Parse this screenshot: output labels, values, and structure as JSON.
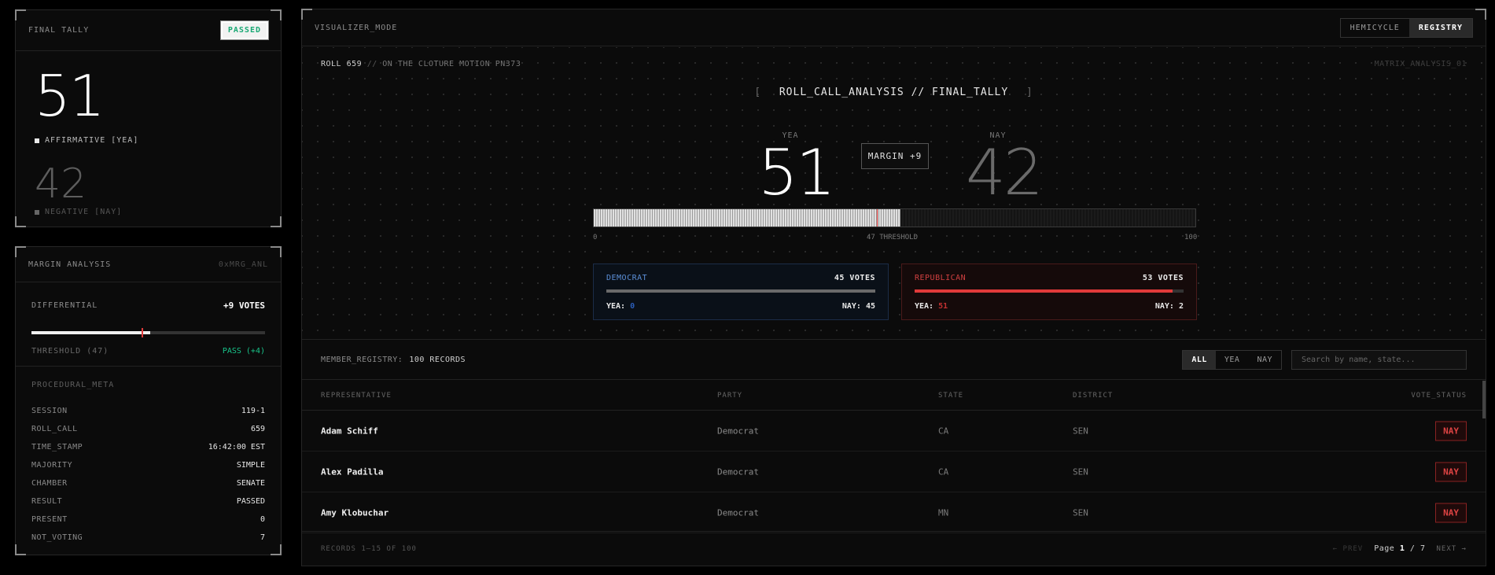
{
  "tally": {
    "title": "FINAL TALLY",
    "status": "PASSED",
    "yea": "51",
    "yea_label": "AFFIRMATIVE [YEA]",
    "nay": "42",
    "nay_label": "NEGATIVE [NAY]"
  },
  "margin": {
    "title": "MARGIN ANALYSIS",
    "code": "0xMRG_ANL",
    "differential_label": "DIFFERENTIAL",
    "differential_value": "+9 VOTES",
    "bar_fill_fraction": 0.51,
    "threshold_fraction": 0.47,
    "threshold_label": "THRESHOLD (47)",
    "threshold_result": "PASS (+4)",
    "procedural_title": "PROCEDURAL_META",
    "meta": [
      {
        "k": "SESSION",
        "v": "119-1"
      },
      {
        "k": "ROLL_CALL",
        "v": "659"
      },
      {
        "k": "TIME_STAMP",
        "v": "16:42:00 EST"
      },
      {
        "k": "MAJORITY",
        "v": "SIMPLE"
      },
      {
        "k": "CHAMBER",
        "v": "SENATE"
      },
      {
        "k": "RESULT",
        "v": "PASSED"
      },
      {
        "k": "PRESENT",
        "v": "0"
      },
      {
        "k": "NOT_VOTING",
        "v": "7"
      }
    ]
  },
  "main": {
    "mode_label": "VISUALIZER_MODE",
    "views": [
      "HEMICYCLE",
      "REGISTRY"
    ],
    "active_view": "REGISTRY",
    "roll_id": "ROLL 659",
    "roll_sep": "//",
    "motion": "ON THE CLOTURE MOTION PN373",
    "matrix_id": "MATRIX_ANALYSIS_01",
    "viz_title": "ROLL_CALL_ANALYSIS // FINAL_TALLY",
    "bracket_l": "[",
    "bracket_r": "]",
    "yea_head": "YEA",
    "nay_head": "NAY",
    "yea_count": "51",
    "nay_count": "42",
    "margin_badge": "MARGIN +9",
    "bar_fill_fraction": 0.51,
    "threshold_fraction": 0.47,
    "scale_min": "0",
    "scale_threshold": "47 THRESHOLD",
    "scale_max": "100"
  },
  "parties": {
    "dem": {
      "name": "DEMOCRAT",
      "votes": "45 VOTES",
      "yea_label": "YEA:",
      "yea": "0",
      "nay_label": "NAY:",
      "nay": "45"
    },
    "rep": {
      "name": "REPUBLICAN",
      "votes": "53 VOTES",
      "yea_label": "YEA:",
      "yea": "51",
      "nay_label": "NAY:",
      "nay": "2",
      "yea_fraction": 0.96
    }
  },
  "registry": {
    "title": "MEMBER_REGISTRY:",
    "count": "100 RECORDS",
    "filters": [
      "ALL",
      "YEA",
      "NAY"
    ],
    "active_filter": "ALL",
    "search_placeholder": "Search by name, state...",
    "columns": [
      "REPRESENTATIVE",
      "PARTY",
      "STATE",
      "DISTRICT",
      "VOTE_STATUS"
    ],
    "rows": [
      {
        "name": "Adam Schiff",
        "party": "Democrat",
        "state": "CA",
        "district": "SEN",
        "vote": "NAY"
      },
      {
        "name": "Alex Padilla",
        "party": "Democrat",
        "state": "CA",
        "district": "SEN",
        "vote": "NAY"
      },
      {
        "name": "Amy Klobuchar",
        "party": "Democrat",
        "state": "MN",
        "district": "SEN",
        "vote": "NAY"
      }
    ],
    "records_info": "RECORDS 1–15 OF 100",
    "prev": "← PREV",
    "page_label": "Page",
    "page": "1",
    "page_sep": "/",
    "pages": "7",
    "next": "NEXT →"
  },
  "colors": {
    "accent_green": "#18c48a",
    "accent_red": "#e03a3a",
    "dem_blue": "#5b8fd8"
  }
}
